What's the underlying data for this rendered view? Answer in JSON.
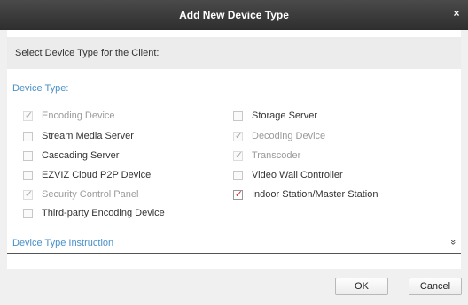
{
  "dialog": {
    "title": "Add New Device Type",
    "close_glyph": "×"
  },
  "prompt": "Select Device Type for the Client:",
  "section_label": "Device Type:",
  "options": [
    {
      "label": "Encoding Device",
      "state": "checked-disabled"
    },
    {
      "label": "Stream Media Server",
      "state": "unchecked"
    },
    {
      "label": "Cascading Server",
      "state": "unchecked"
    },
    {
      "label": "EZVIZ Cloud P2P Device",
      "state": "unchecked"
    },
    {
      "label": "Security Control Panel",
      "state": "checked-disabled"
    },
    {
      "label": "Third-party Encoding Device",
      "state": "unchecked"
    },
    {
      "label": "Storage Server",
      "state": "unchecked"
    },
    {
      "label": "Decoding Device",
      "state": "checked-disabled"
    },
    {
      "label": "Transcoder",
      "state": "checked-disabled"
    },
    {
      "label": "Video Wall Controller",
      "state": "unchecked"
    },
    {
      "label": "Indoor Station/Master Station",
      "state": "checked"
    }
  ],
  "instruction": {
    "label": "Device Type Instruction",
    "toggle_glyph": "»"
  },
  "buttons": {
    "ok": "OK",
    "cancel": "Cancel"
  },
  "check_glyph": "✓"
}
